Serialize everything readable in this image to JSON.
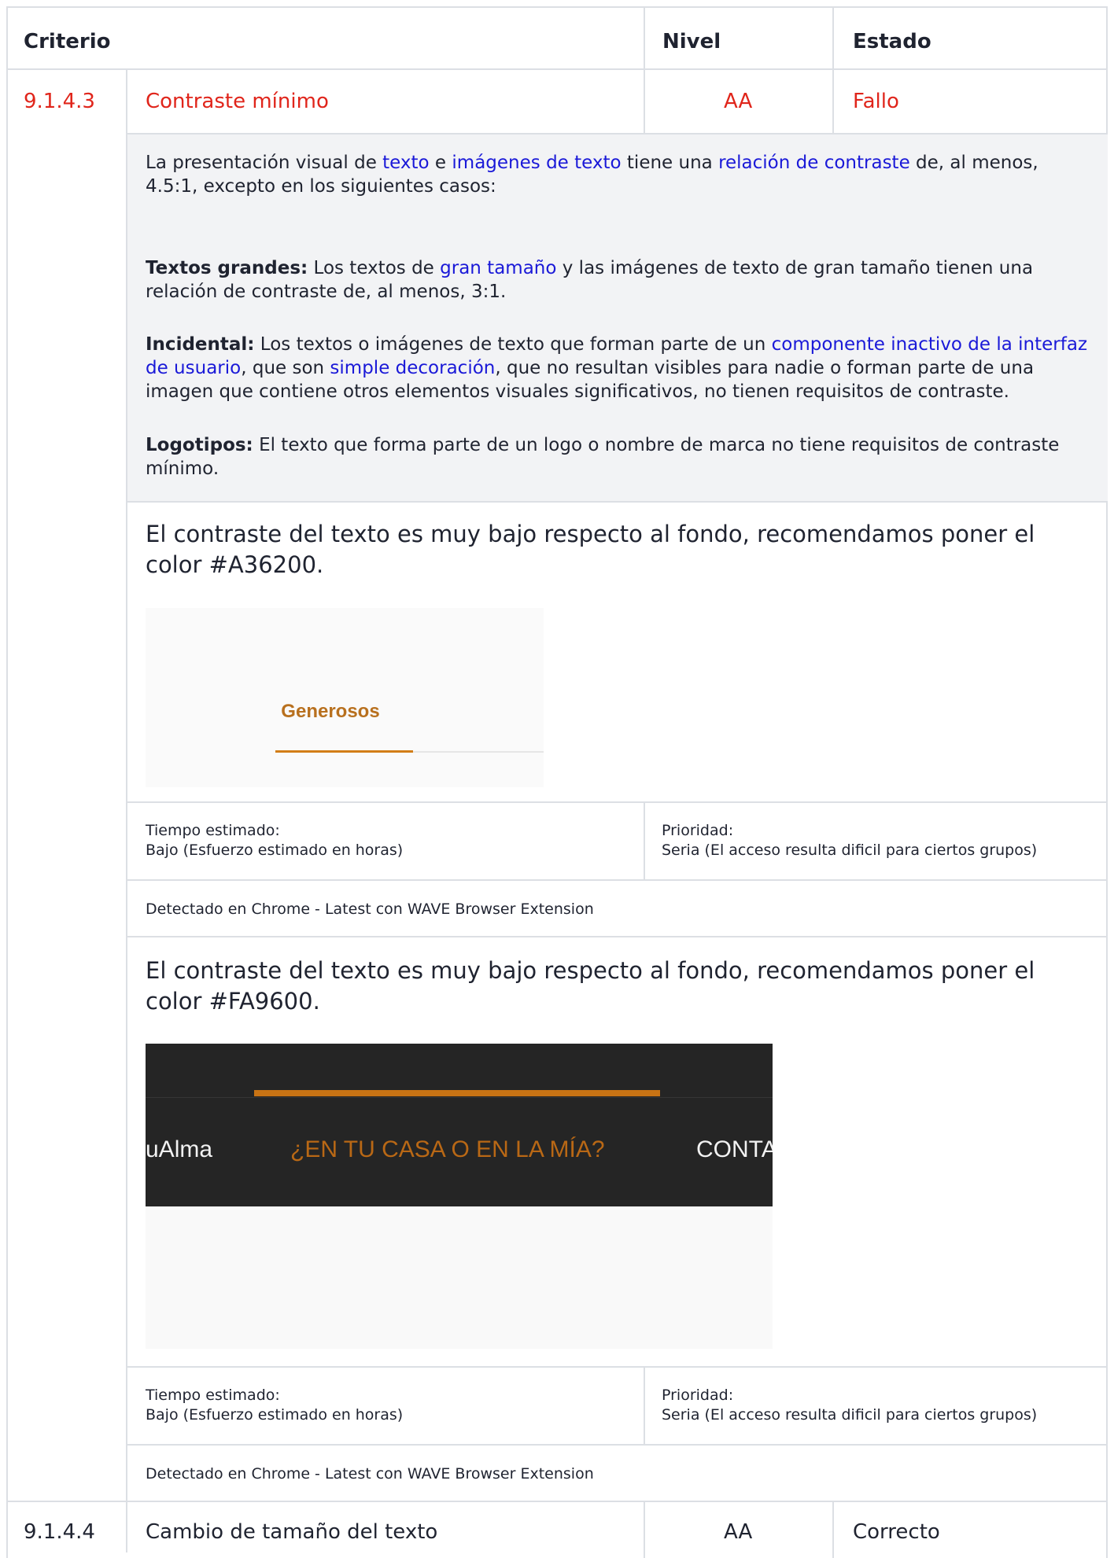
{
  "header": {
    "criterio": "Criterio",
    "nivel": "Nivel",
    "estado": "Estado"
  },
  "criteria": [
    {
      "id": "9.1.4.3",
      "name": "Contraste mínimo",
      "level": "AA",
      "status": "Fallo",
      "description": {
        "p1": {
          "t1": "La presentación visual de ",
          "link1": "texto",
          "t2": " e ",
          "link2": "imágenes de texto",
          "t3": " tiene una ",
          "link3": "relación de contraste",
          "t4": " de, al menos, 4.5:1, excepto en los siguientes casos:"
        },
        "p2": {
          "bold": "Textos grandes:",
          "t1": " Los textos de ",
          "link1": "gran tamaño",
          "t2": " y las imágenes de texto de gran tamaño tienen una relación de contraste de, al menos, 3:1."
        },
        "p3": {
          "bold": "Incidental:",
          "t1": " Los textos o imágenes de texto que forman parte de un ",
          "link1": "componente inactivo de la interfaz de usuario",
          "t2": ", que son ",
          "link2": "simple decoración",
          "t3": ", que no resultan visibles para nadie o forman parte de una imagen que contiene otros elementos visuales significativos, no tienen requisitos de contraste."
        },
        "p4": {
          "bold": "Logotipos:",
          "t1": " El texto que forma parte de un logo o nombre de marca no tiene requisitos de contraste mínimo."
        }
      },
      "findings": [
        {
          "text": "El contraste del texto es muy bajo respecto al fondo, recomendamos poner el color #A36200.",
          "screenshot": {
            "label": "Generosos"
          },
          "time_label": "Tiempo estimado:",
          "time_value": "Bajo (Esfuerzo estimado en horas)",
          "priority_label": "Prioridad:",
          "priority_value": "Seria (El acceso resulta dificil para ciertos grupos)",
          "detected": "Detectado en Chrome - Latest con WAVE Browser Extension"
        },
        {
          "text": "El contraste del texto es muy bajo respecto al fondo, recomendamos poner el color #FA9600.",
          "screenshot": {
            "menu": [
              "uAlma",
              "¿EN TU CASA O EN LA MÍA?",
              "CONTA"
            ]
          },
          "time_label": "Tiempo estimado:",
          "time_value": "Bajo (Esfuerzo estimado en horas)",
          "priority_label": "Prioridad:",
          "priority_value": "Seria (El acceso resulta dificil para ciertos grupos)",
          "detected": "Detectado en Chrome - Latest con WAVE Browser Extension"
        }
      ]
    },
    {
      "id": "9.1.4.4",
      "name": "Cambio de tamaño del texto",
      "level": "AA",
      "status": "Correcto"
    }
  ],
  "colors": {
    "fail": "#e0251b",
    "link": "#1a19d8",
    "border": "#dcdfe4",
    "description_bg": "#f2f3f5"
  }
}
